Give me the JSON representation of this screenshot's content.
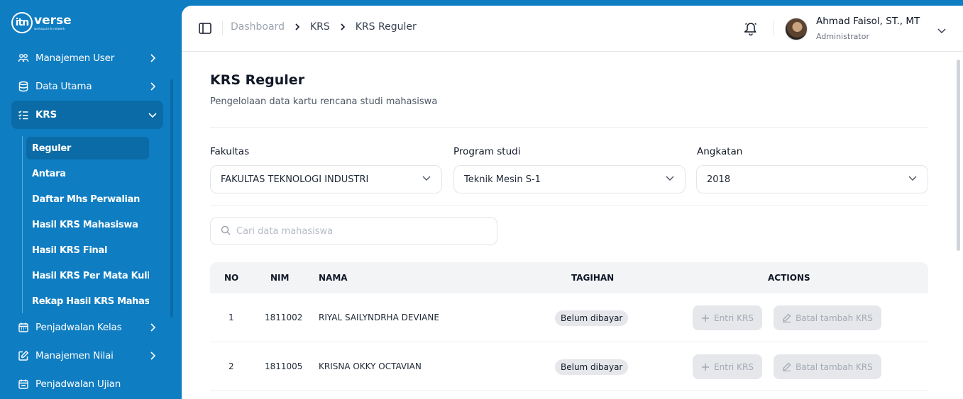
{
  "brand": {
    "mark": "itn",
    "name": "verse",
    "tagline": "workspace & network"
  },
  "sidebar": {
    "items": [
      {
        "label": "Manajemen User",
        "icon": "users-icon"
      },
      {
        "label": "Data Utama",
        "icon": "database-icon"
      },
      {
        "label": "KRS",
        "icon": "list-check-icon"
      },
      {
        "label": "Penjadwalan Kelas",
        "icon": "calendar-icon"
      },
      {
        "label": "Manajemen Nilai",
        "icon": "edit-square-icon"
      },
      {
        "label": "Penjadwalan Ujian",
        "icon": "calendar-icon"
      }
    ],
    "krs_sub": [
      {
        "label": "Reguler"
      },
      {
        "label": "Antara"
      },
      {
        "label": "Daftar Mhs Perwalian"
      },
      {
        "label": "Hasil KRS Mahasiswa"
      },
      {
        "label": "Hasil KRS Final"
      },
      {
        "label": "Hasil KRS Per Mata Kuliah"
      },
      {
        "label": "Rekap Hasil KRS Mahasi..."
      }
    ]
  },
  "breadcrumb": [
    "Dashboard",
    "KRS",
    "KRS Reguler"
  ],
  "user": {
    "name": "Ahmad Faisol, ST., MT",
    "role": "Administrator"
  },
  "page": {
    "title": "KRS Reguler",
    "subtitle": "Pengelolaan data kartu rencana studi mahasiswa"
  },
  "filters": {
    "fakultas": {
      "label": "Fakultas",
      "value": "FAKULTAS TEKNOLOGI INDUSTRI"
    },
    "prodi": {
      "label": "Program studi",
      "value": "Teknik Mesin S-1"
    },
    "angkatan": {
      "label": "Angkatan",
      "value": "2018"
    }
  },
  "search": {
    "placeholder": "Cari data mahasiswa",
    "value": ""
  },
  "table": {
    "headers": {
      "no": "NO",
      "nim": "NIM",
      "nama": "NAMA",
      "tagihan": "TAGIHAN",
      "actions": "ACTIONS"
    },
    "rows": [
      {
        "no": "1",
        "nim": "1811002",
        "nama": "RIYAL SAILYNDRHA DEVIANE",
        "tagihan": "Belum dibayar",
        "entri": "Entri KRS",
        "batal": "Batal tambah KRS"
      },
      {
        "no": "2",
        "nim": "1811005",
        "nama": "KRISNA OKKY OCTAVIAN",
        "tagihan": "Belum dibayar",
        "entri": "Entri KRS",
        "batal": "Batal tambah KRS"
      }
    ]
  },
  "colors": {
    "sidebar": "#0f7dc2",
    "sidebar_active": "#0a6ba6",
    "badge": "#e5e7eb"
  }
}
